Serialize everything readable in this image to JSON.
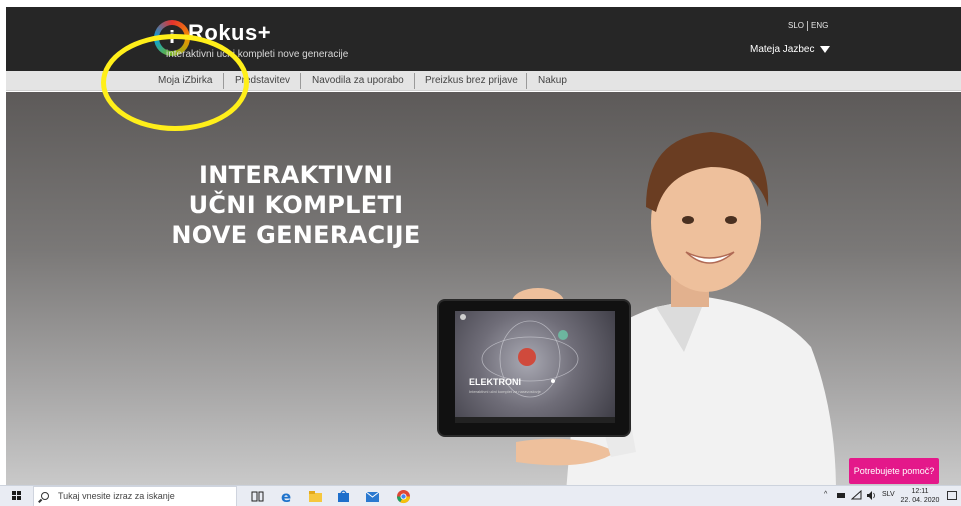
{
  "header": {
    "logo_letter": "i",
    "logo_name": "Rokus",
    "logo_plus": "+",
    "tagline": "interaktivni učni kompleti nove generacije",
    "lang_slo": "SLO",
    "lang_eng": "ENG",
    "user_name": "Mateja Jazbec"
  },
  "nav": {
    "items": [
      {
        "label": "Moja iZbirka"
      },
      {
        "label": "Predstavitev"
      },
      {
        "label": "Navodila za uporabo"
      },
      {
        "label": "Preizkus brez prijave"
      },
      {
        "label": "Nakup"
      }
    ]
  },
  "hero": {
    "line1": "INTERAKTIVNI",
    "line2": "UČNI KOMPLETI",
    "line3": "NOVE GENERACIJE"
  },
  "tablet": {
    "title": "ELEKTRONI",
    "caption": "Interaktivni učni komplet za naravoslovje"
  },
  "help_button": "Potrebujete pomoč?",
  "taskbar": {
    "search_placeholder": "Tukaj vnesite izraz za iskanje",
    "language": "SLV",
    "time": "12:11",
    "date": "22. 04. 2020"
  },
  "colors": {
    "header_bg": "#262626",
    "nav_bg": "#e4e4e4",
    "accent_pink": "#e4188a",
    "annotation_yellow": "#ffef1a"
  }
}
